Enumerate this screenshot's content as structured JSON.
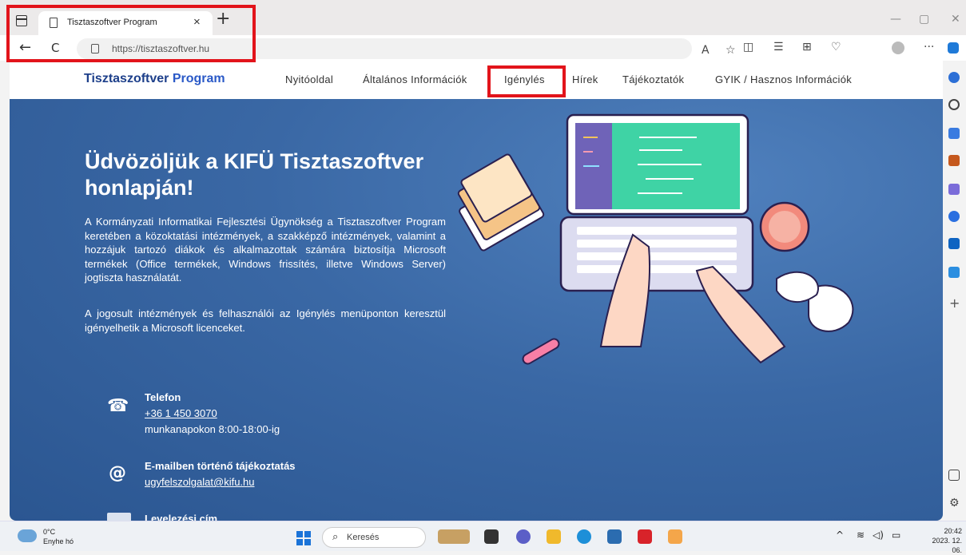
{
  "browser": {
    "tab_title": "Tisztaszoftver Program",
    "tab_close": "×",
    "new_tab": "+",
    "url": "https://tisztaszoftver.hu",
    "back": "←",
    "reload": "C",
    "minimize": "—",
    "restore": "▢",
    "close": "✕"
  },
  "site": {
    "brand_part1": "Tisztaszoftver",
    "brand_part2": "Program",
    "nav": [
      "Nyitóoldal",
      "Általános Információk",
      "Igénylés",
      "Hírek",
      "Tájékoztatók",
      "GYIK / Hasznos Információk"
    ],
    "hero_title": "Üdvözöljük a KIFÜ Tisztaszoftver honlapján!",
    "paragraph1": "A Kormányzati Informatikai Fejlesztési Ügynökség a Tisztaszoftver Program keretében a közoktatási intézmények, a szakképző intézmények, valamint a hozzájuk tartozó diákok és alkalmazottak számára biztosítja Microsoft termékek (Office termékek, Windows frissítés, illetve Windows Server) jogtiszta használatát.",
    "paragraph2": "A jogosult intézmények és felhasználói az Igénylés menüponton keresztül igényelhetik a Microsoft licenceket.",
    "contacts": {
      "phone_title": "Telefon",
      "phone_number": "+36 1 450 3070",
      "phone_hours": "munkanapokon 8:00-18:00-ig",
      "email_title": "E-mailben történő tájékoztatás",
      "email_address": "ugyfelszolgalat@kifu.hu",
      "postal_title": "Levelezési cím"
    }
  },
  "taskbar": {
    "temperature": "0°C",
    "weather": "Enyhe hó",
    "search_placeholder": "Keresés",
    "time": "20:42",
    "date": "2023. 12. 06."
  },
  "colors": {
    "highlight": "#e2141b",
    "brand": "#1d3f8a",
    "hero": "#3a68a5"
  }
}
